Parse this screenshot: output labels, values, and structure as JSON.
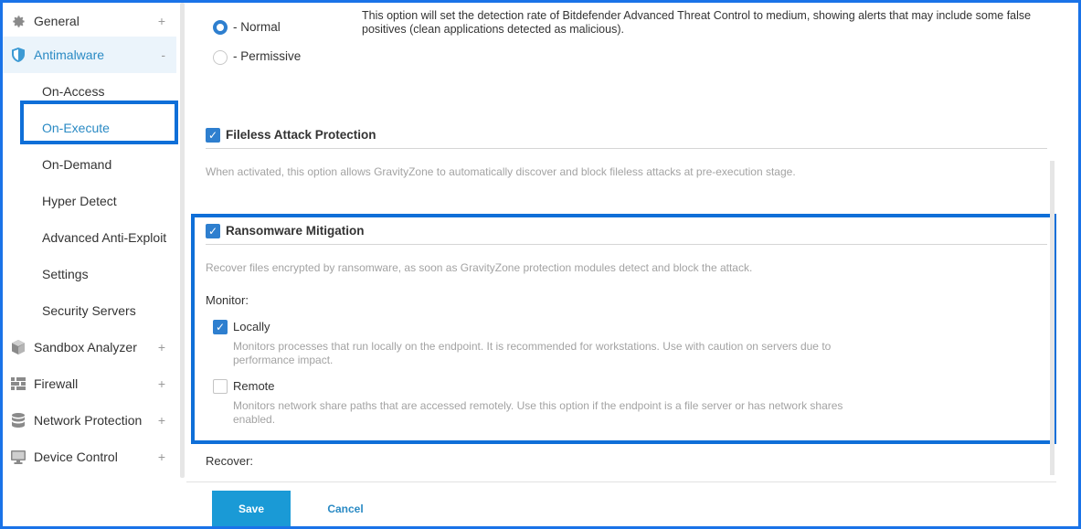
{
  "sidebar": {
    "items": [
      {
        "label": "General",
        "icon": "gear-icon",
        "expander": "+"
      },
      {
        "label": "Antimalware",
        "icon": "shield-icon",
        "expander": "-"
      },
      {
        "label": "Sandbox Analyzer",
        "icon": "cube-icon",
        "expander": "+"
      },
      {
        "label": "Firewall",
        "icon": "firewall-icon",
        "expander": "+"
      },
      {
        "label": "Network Protection",
        "icon": "database-icon",
        "expander": "+"
      },
      {
        "label": "Device Control",
        "icon": "monitor-icon",
        "expander": "+"
      }
    ],
    "subitems": [
      {
        "label": "On-Access"
      },
      {
        "label": "On-Execute"
      },
      {
        "label": "On-Demand"
      },
      {
        "label": "Hyper Detect"
      },
      {
        "label": "Advanced Anti-Exploit"
      },
      {
        "label": "Settings"
      },
      {
        "label": "Security Servers"
      }
    ]
  },
  "detection": {
    "normal_label": "- Normal",
    "permissive_label": "- Permissive",
    "normal_desc": "This option will set the detection rate of Bitdefender Advanced Threat Control to medium, showing alerts that may include some false positives (clean applications detected as malicious).",
    "selected": "normal"
  },
  "fileless": {
    "title": "Fileless Attack Protection",
    "checked": true,
    "desc": "When activated, this option allows GravityZone to automatically discover and block fileless attacks at pre-execution stage."
  },
  "ransomware": {
    "title": "Ransomware Mitigation",
    "checked": true,
    "desc": "Recover files encrypted by ransomware, as soon as GravityZone protection modules detect and block the attack.",
    "monitor_label": "Monitor:",
    "locally": {
      "label": "Locally",
      "checked": true,
      "desc": "Monitors processes that run locally on the endpoint. It is recommended for workstations. Use with caution on servers due to performance impact."
    },
    "remote": {
      "label": "Remote",
      "checked": false,
      "desc": "Monitors network share paths that are accessed remotely. Use this option if the endpoint is a file server or has network shares enabled."
    },
    "recover_label": "Recover:"
  },
  "footer": {
    "save_label": "Save",
    "cancel_label": "Cancel"
  },
  "colors": {
    "accent": "#2e7fcf",
    "highlight": "#0f6fd8",
    "save_button": "#1a9ad6"
  }
}
